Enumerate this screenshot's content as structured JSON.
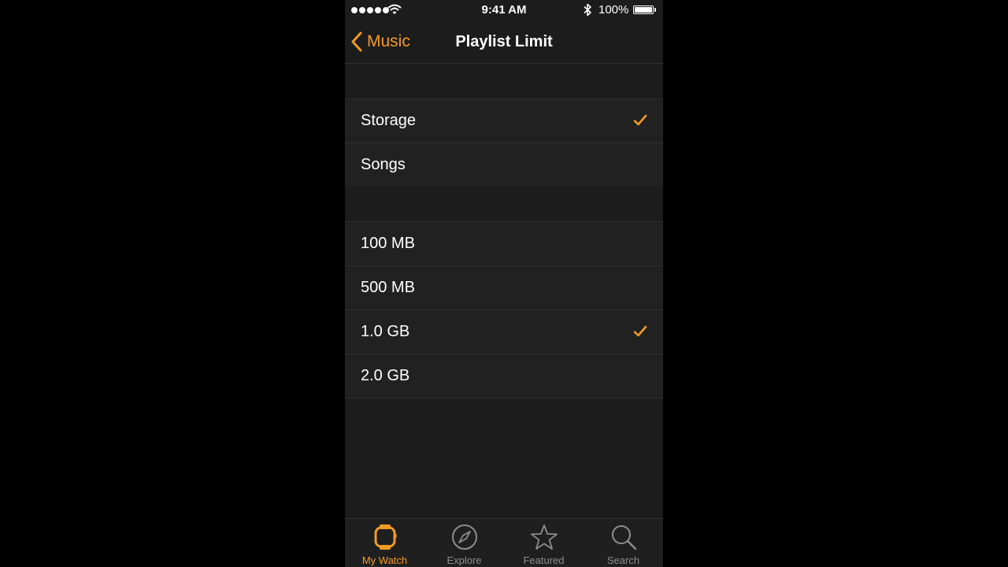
{
  "status_bar": {
    "time": "9:41 AM",
    "battery_percent": "100%",
    "icons": [
      "signal-dots-icon",
      "wifi-icon",
      "bluetooth-icon",
      "battery-icon"
    ]
  },
  "nav": {
    "back_label": "Music",
    "title": "Playlist Limit"
  },
  "limit_type": {
    "items": [
      {
        "label": "Storage",
        "selected": true
      },
      {
        "label": "Songs",
        "selected": false
      }
    ]
  },
  "limit_amount": {
    "items": [
      {
        "label": "100 MB",
        "selected": false
      },
      {
        "label": "500 MB",
        "selected": false
      },
      {
        "label": "1.0 GB",
        "selected": true
      },
      {
        "label": "2.0 GB",
        "selected": false
      }
    ]
  },
  "tab_bar": {
    "tabs": [
      {
        "label": "My Watch",
        "icon": "watch-icon",
        "active": true
      },
      {
        "label": "Explore",
        "icon": "compass-icon",
        "active": false
      },
      {
        "label": "Featured",
        "icon": "star-icon",
        "active": false
      },
      {
        "label": "Search",
        "icon": "search-icon",
        "active": false
      }
    ]
  },
  "colors": {
    "accent": "#f39b26",
    "background": "#1c1c1c",
    "cell": "#212121",
    "separator": "#2f2f2f",
    "inactive_tab": "#8e8e8e"
  }
}
